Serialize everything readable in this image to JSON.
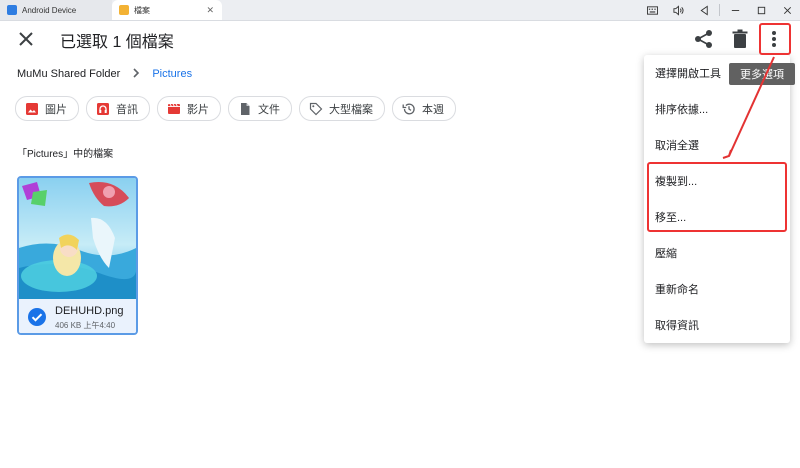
{
  "window": {
    "tabs": [
      {
        "label": "Android Device"
      },
      {
        "label": "檔案"
      }
    ]
  },
  "appbar": {
    "title": "已選取 1 個檔案"
  },
  "breadcrumb": {
    "root": "MuMu Shared Folder",
    "current": "Pictures"
  },
  "chips": [
    {
      "label": "圖片",
      "icon": "image-icon"
    },
    {
      "label": "音訊",
      "icon": "headphones-icon"
    },
    {
      "label": "影片",
      "icon": "video-icon"
    },
    {
      "label": "文件",
      "icon": "document-icon"
    },
    {
      "label": "大型檔案",
      "icon": "tag-icon"
    },
    {
      "label": "本週",
      "icon": "history-icon"
    }
  ],
  "section_label": "「Pictures」中的檔案",
  "file": {
    "name": "DEHUHD.png",
    "meta": "406 KB 上午4:40",
    "selected": true
  },
  "tooltip": "更多選項",
  "menu": {
    "items": [
      "選擇開啟工具",
      "排序依據...",
      "取消全選",
      "複製到...",
      "移至...",
      "壓縮",
      "重新命名",
      "取得資訊"
    ]
  },
  "colors": {
    "accent": "#1a73e8",
    "chip_red": "#e53935",
    "selection": "#5b9be6",
    "annotation": "#e33333"
  }
}
